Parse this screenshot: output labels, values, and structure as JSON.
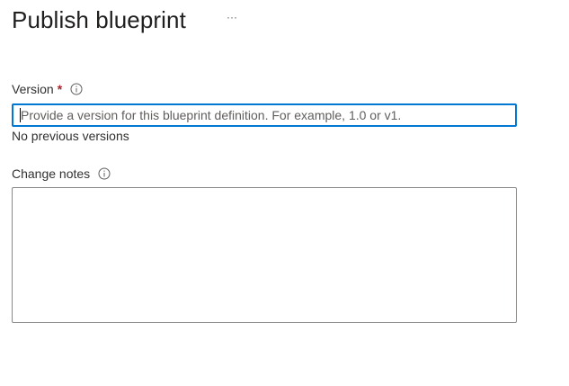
{
  "header": {
    "title": "Publish blueprint",
    "more_label": "···"
  },
  "version": {
    "label": "Version",
    "required_marker": "*",
    "value": "",
    "placeholder": "Provide a version for this blueprint definition. For example, 1.0 or v1.",
    "helper_text": "No previous versions",
    "info_icon": "info-icon"
  },
  "change_notes": {
    "label": "Change notes",
    "value": "",
    "info_icon": "info-icon"
  },
  "colors": {
    "accent": "#0078d4",
    "required": "#a4262c",
    "text": "#323130",
    "border": "#8a8886"
  }
}
